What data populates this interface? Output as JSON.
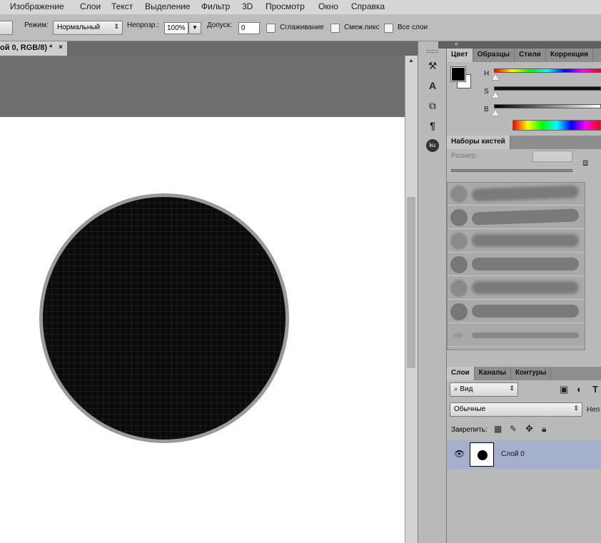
{
  "menu": [
    "Изображение",
    "Слои",
    "Текст",
    "Выделение",
    "Фильтр",
    "3D",
    "Просмотр",
    "Окно",
    "Справка"
  ],
  "options": {
    "mode_label": "Режим:",
    "mode_value": "Нормальный",
    "opacity_label": "Непрозр.:",
    "opacity_value": "100%",
    "tolerance_label": "Допуск:",
    "tolerance_value": "0",
    "antialias_label": "Сглаживание",
    "contiguous_label": "Смеж.пикс",
    "all_layers_label": "Все слои"
  },
  "document": {
    "tab_label": "ой 0, RGB/8) *",
    "close": "×"
  },
  "color_panel": {
    "tabs": [
      "Цвет",
      "Образцы",
      "Стили",
      "Коррекция"
    ],
    "slider_labels": [
      "H",
      "S",
      "B"
    ]
  },
  "brush_panel": {
    "tab": "Наборы кистей",
    "size_label": "Размер:"
  },
  "layers_panel": {
    "tabs": [
      "Слои",
      "Каналы",
      "Контуры"
    ],
    "filter_value": "Вид",
    "blend_value": "Обычные",
    "opacity_label": "Неп",
    "lock_label": "Закрепить:",
    "layer_name": "Слой 0"
  },
  "tools": [
    "brush-tool-icon",
    "type-tool-icon",
    "clone-source-icon",
    "paragraph-icon",
    "kuler-icon"
  ]
}
